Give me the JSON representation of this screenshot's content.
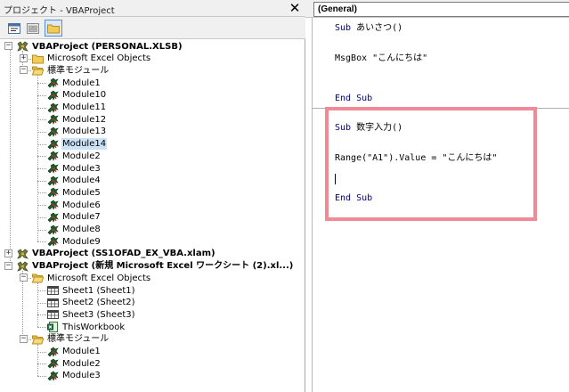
{
  "project_explorer": {
    "title": "プロジェクト - VBAProject",
    "close_glyph": "✕",
    "toolbar": {
      "view_code_icon": "view-code-icon",
      "view_object_icon": "view-object-icon",
      "toggle_folders_icon": "folder-icon"
    },
    "tree": [
      {
        "label": "VBAProject (PERSONAL.XLSB)",
        "type": "project",
        "level": 0,
        "expander": "−"
      },
      {
        "label": "Microsoft Excel Objects",
        "type": "folder",
        "level": 1,
        "expander": "+"
      },
      {
        "label": "標準モジュール",
        "type": "folder-open",
        "level": 1,
        "expander": "−"
      },
      {
        "label": "Module1",
        "type": "module",
        "level": 2
      },
      {
        "label": "Module10",
        "type": "module",
        "level": 2
      },
      {
        "label": "Module11",
        "type": "module",
        "level": 2
      },
      {
        "label": "Module12",
        "type": "module",
        "level": 2
      },
      {
        "label": "Module13",
        "type": "module",
        "level": 2
      },
      {
        "label": "Module14",
        "type": "module",
        "level": 2,
        "selected": true
      },
      {
        "label": "Module2",
        "type": "module",
        "level": 2
      },
      {
        "label": "Module3",
        "type": "module",
        "level": 2
      },
      {
        "label": "Module4",
        "type": "module",
        "level": 2
      },
      {
        "label": "Module5",
        "type": "module",
        "level": 2
      },
      {
        "label": "Module6",
        "type": "module",
        "level": 2
      },
      {
        "label": "Module7",
        "type": "module",
        "level": 2
      },
      {
        "label": "Module8",
        "type": "module",
        "level": 2
      },
      {
        "label": "Module9",
        "type": "module",
        "level": 2
      },
      {
        "label": "VBAProject (SS1OFAD_EX_VBA.xlam)",
        "type": "project",
        "level": 0,
        "expander": "+"
      },
      {
        "label": "VBAProject (新規 Microsoft Excel ワークシート (2).xl...)",
        "type": "project",
        "level": 0,
        "expander": "−"
      },
      {
        "label": "Microsoft Excel Objects",
        "type": "folder-open",
        "level": 1,
        "expander": "−"
      },
      {
        "label": "Sheet1 (Sheet1)",
        "type": "sheet",
        "level": 2
      },
      {
        "label": "Sheet2 (Sheet2)",
        "type": "sheet",
        "level": 2
      },
      {
        "label": "Sheet3 (Sheet3)",
        "type": "sheet",
        "level": 2
      },
      {
        "label": "ThisWorkbook",
        "type": "workbook",
        "level": 2
      },
      {
        "label": "標準モジュール",
        "type": "folder-open",
        "level": 1,
        "expander": "−"
      },
      {
        "label": "Module1",
        "type": "module",
        "level": 2
      },
      {
        "label": "Module2",
        "type": "module",
        "level": 2
      },
      {
        "label": "Module3",
        "type": "module",
        "level": 2
      }
    ]
  },
  "code_window": {
    "object_combo_value": "(General)",
    "lines": [
      {
        "segments": [
          {
            "text": "Sub",
            "kw": true
          },
          {
            "text": " あいさつ()"
          }
        ]
      },
      {
        "segments": [
          {
            "text": "MsgBox \"こんにちは\""
          }
        ]
      },
      {
        "segments": [
          {
            "text": "End Sub",
            "kw": true
          }
        ]
      },
      {
        "segments": [
          {
            "text": "Sub",
            "kw": true
          },
          {
            "text": " 数字入力()"
          }
        ]
      },
      {
        "segments": [
          {
            "text": "Range(\"A1\").Value = \"こんにちは\""
          }
        ]
      },
      {
        "segments": [
          {
            "text": "End Sub",
            "kw": true
          }
        ]
      }
    ]
  },
  "colors": {
    "highlight_border": "#ef8a96",
    "selection_bg": "#cce2f7",
    "keyword": "#00007f"
  }
}
